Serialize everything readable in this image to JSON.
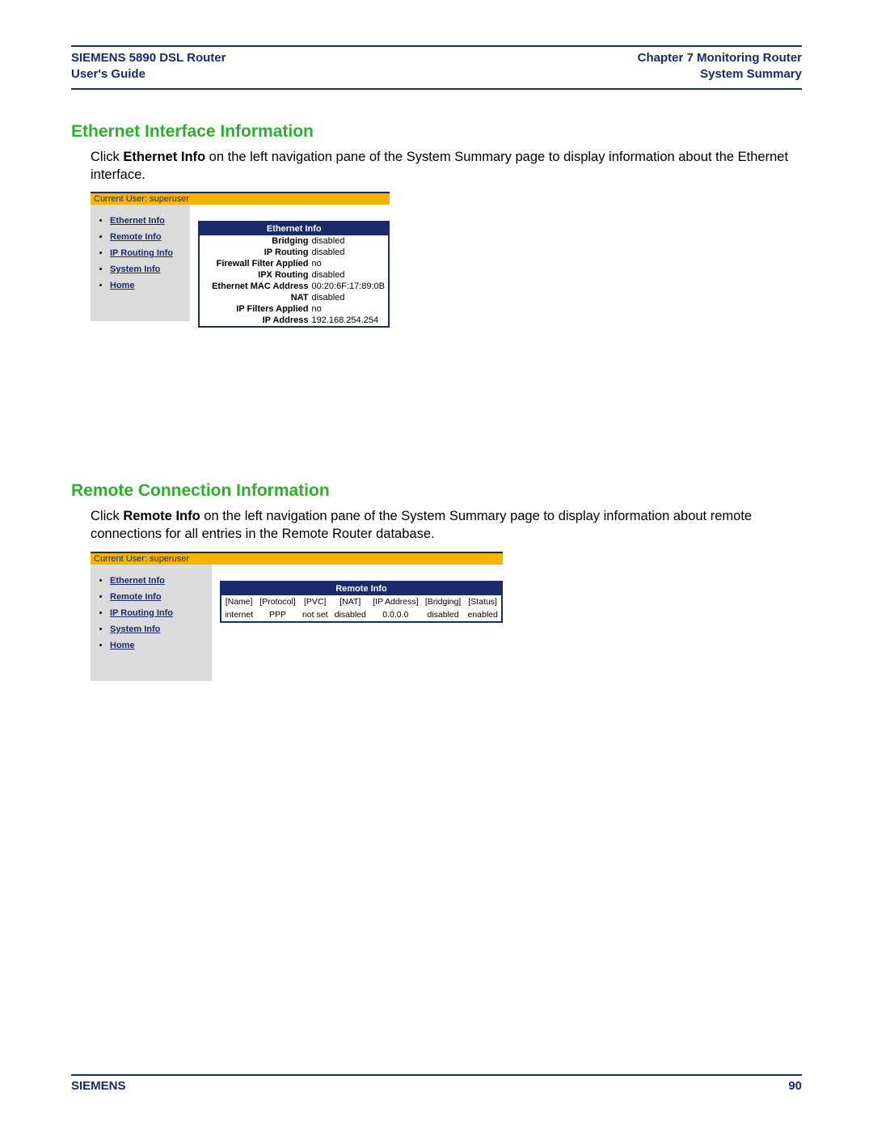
{
  "header": {
    "left_line1": "SIEMENS 5890 DSL Router",
    "left_line2": "User's Guide",
    "right_line1": "Chapter 7  Monitoring Router",
    "right_line2": "System Summary"
  },
  "section1": {
    "heading": "Ethernet Interface Information",
    "text_pre": "Click ",
    "text_bold": "Ethernet Info",
    "text_post": " on the left navigation pane of the System Summary page to display information about the Ethernet interface.",
    "userbar": "Current User: superuser",
    "nav": [
      "Ethernet Info",
      "Remote Info",
      "IP Routing Info",
      "System Info",
      "Home"
    ],
    "panel_title": "Ethernet Info",
    "rows": [
      {
        "label": "Bridging",
        "value": "disabled"
      },
      {
        "label": "IP Routing",
        "value": "disabled"
      },
      {
        "label": "Firewall Filter Applied",
        "value": "no"
      },
      {
        "label": "IPX Routing",
        "value": "disabled"
      },
      {
        "label": "Ethernet MAC Address",
        "value": "00:20:6F:17:89:0B"
      },
      {
        "label": "NAT",
        "value": "disabled"
      },
      {
        "label": "IP Filters Applied",
        "value": "no"
      },
      {
        "label": "IP Address",
        "value": "192.168.254.254"
      }
    ]
  },
  "section2": {
    "heading": "Remote Connection Information",
    "text_pre": "Click ",
    "text_bold": "Remote Info",
    "text_post": " on the left navigation pane of the System Summary page to display information about remote connections for all entries in the Remote Router database.",
    "userbar": "Current User: superuser",
    "nav": [
      "Ethernet Info",
      "Remote Info",
      "IP Routing Info",
      "System Info",
      "Home"
    ],
    "panel_title": "Remote Info",
    "columns": [
      "[Name]",
      "[Protocol]",
      "[PVC]",
      "[NAT]",
      "[IP Address]",
      "[Bridging]",
      "[Status]"
    ],
    "row": [
      "internet",
      "PPP",
      "not set",
      "disabled",
      "0.0.0.0",
      "disabled",
      "enabled"
    ]
  },
  "footer": {
    "brand": "SIEMENS",
    "page": "90"
  }
}
